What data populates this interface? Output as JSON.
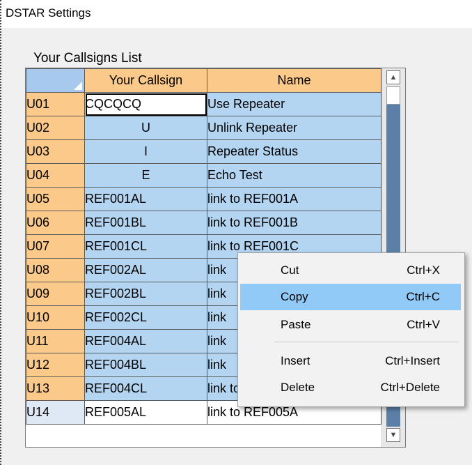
{
  "window": {
    "title": "DSTAR Settings"
  },
  "group": {
    "label": "Your Callsigns List"
  },
  "grid": {
    "columns": [
      "",
      "Your Callsign",
      "Name"
    ],
    "rows": [
      {
        "id": "U01",
        "callsign": "CQCQCQ",
        "name": "Use Repeater"
      },
      {
        "id": "U02",
        "callsign": "U",
        "name": "Unlink Repeater"
      },
      {
        "id": "U03",
        "callsign": "I",
        "name": "Repeater Status"
      },
      {
        "id": "U04",
        "callsign": "E",
        "name": "Echo Test"
      },
      {
        "id": "U05",
        "callsign": "REF001AL",
        "name": "link to REF001A"
      },
      {
        "id": "U06",
        "callsign": "REF001BL",
        "name": "link to REF001B"
      },
      {
        "id": "U07",
        "callsign": "REF001CL",
        "name": "link to REF001C"
      },
      {
        "id": "U08",
        "callsign": "REF002AL",
        "name": "link"
      },
      {
        "id": "U09",
        "callsign": "REF002BL",
        "name": "link"
      },
      {
        "id": "U10",
        "callsign": "REF002CL",
        "name": "link"
      },
      {
        "id": "U11",
        "callsign": "REF004AL",
        "name": "link"
      },
      {
        "id": "U12",
        "callsign": "REF004BL",
        "name": "link"
      },
      {
        "id": "U13",
        "callsign": "REF004CL",
        "name": "link to REF004C"
      },
      {
        "id": "U14",
        "callsign": "REF005AL",
        "name": "link to REF005A"
      }
    ]
  },
  "context_menu": {
    "items": [
      {
        "label": "Cut",
        "shortcut": "Ctrl+X"
      },
      {
        "label": "Copy",
        "shortcut": "Ctrl+C"
      },
      {
        "label": "Paste",
        "shortcut": "Ctrl+V"
      },
      {
        "label": "Insert",
        "shortcut": "Ctrl+Insert"
      },
      {
        "label": "Delete",
        "shortcut": "Ctrl+Delete"
      }
    ],
    "highlighted": "Copy"
  },
  "colors": {
    "row_header": "#fbc98a",
    "selected_cell": "#b3d5f2",
    "menu_highlight": "#91c9f7"
  }
}
